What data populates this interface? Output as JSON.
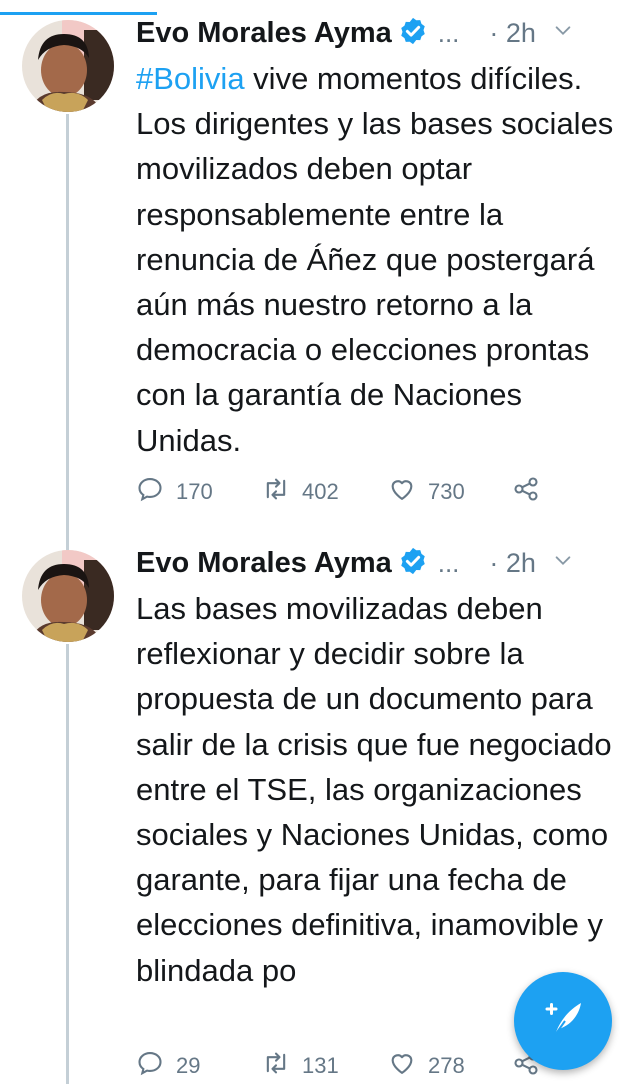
{
  "colors": {
    "accent": "#1da1f2",
    "text": "#14171a",
    "secondary": "#657786",
    "thread_line": "#c4cfd6"
  },
  "tweets": [
    {
      "author": "Evo Morales Ayma",
      "handle": "...",
      "time": "· 2h",
      "hashtag": "#Bolivia",
      "text": " vive momentos difíciles. Los dirigentes y las bases sociales movilizados deben optar responsablemente entre la renuncia de Áñez que postergará aún más nuestro retorno a la democracia o elecciones prontas con la garantía de Naciones Unidas.",
      "replies": "170",
      "retweets": "402",
      "likes": "730"
    },
    {
      "author": "Evo Morales Ayma",
      "handle": "...",
      "time": "· 2h",
      "text": "Las bases movilizadas deben reflexionar y decidir sobre la propuesta de un documento para salir de la crisis que fue negociado entre el TSE, las organizaciones sociales y Naciones Unidas, como garante, para fijar una fecha de elecciones definitiva, inamovible y blindada po",
      "replies": "29",
      "retweets": "131",
      "likes": "278"
    }
  ],
  "icons": {
    "verified": "verified-badge-icon",
    "chevron": "chevron-down-icon",
    "reply": "reply-icon",
    "retweet": "retweet-icon",
    "like": "heart-icon",
    "share": "share-icon",
    "compose": "compose-tweet-icon"
  }
}
